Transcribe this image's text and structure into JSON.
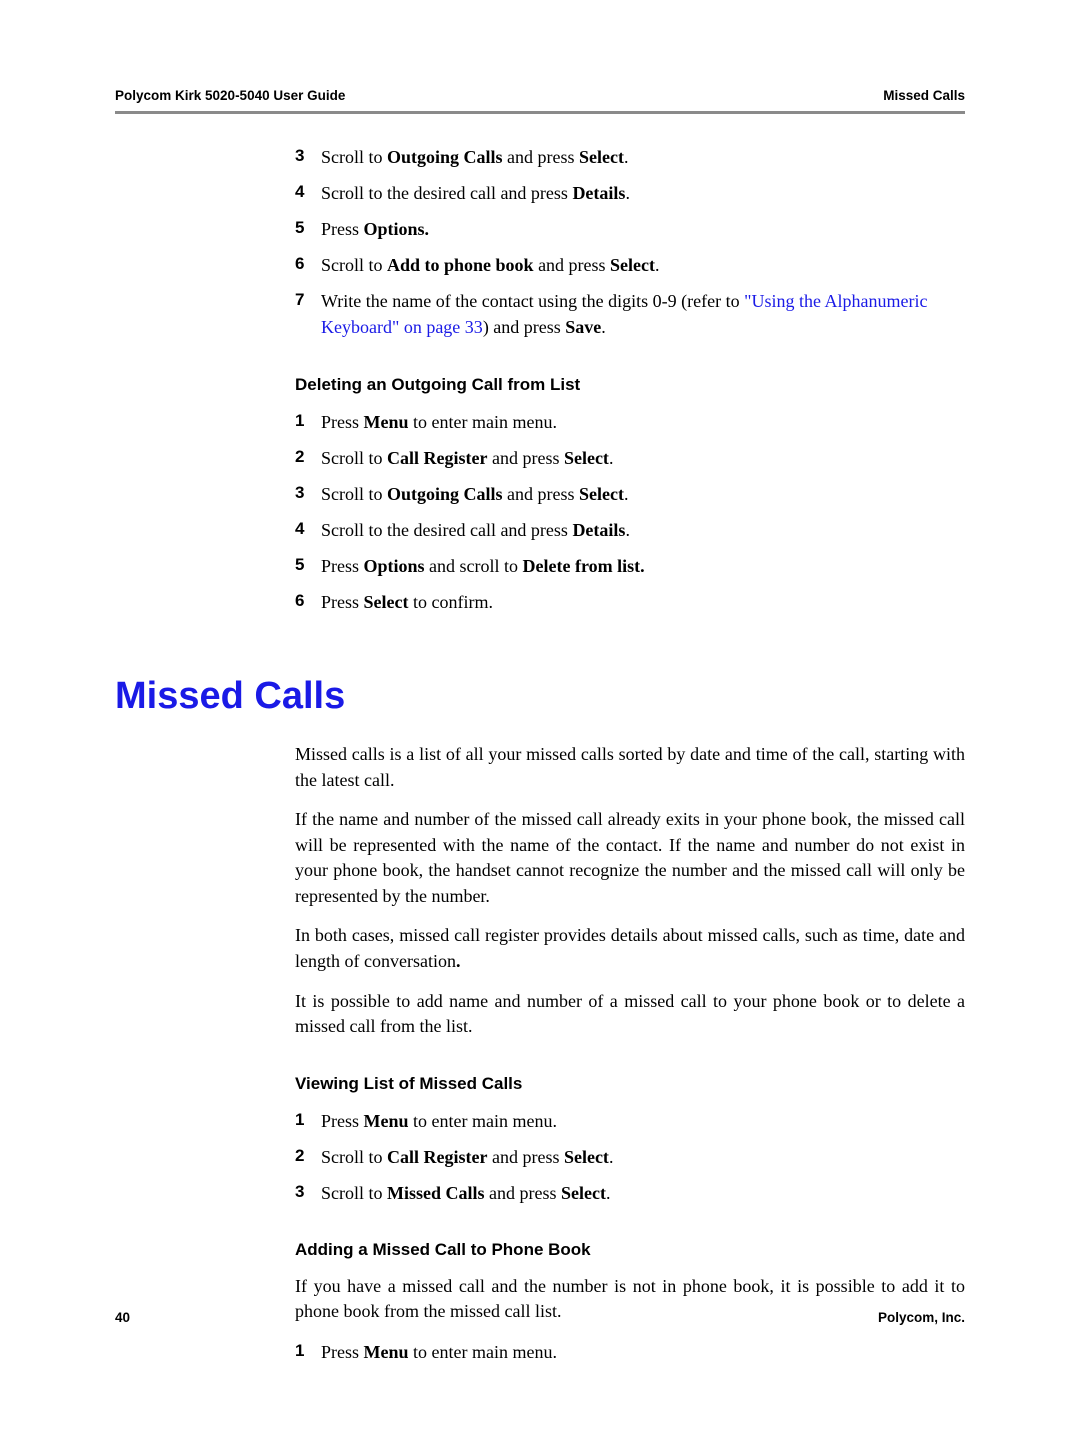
{
  "header": {
    "left": "Polycom Kirk 5020-5040 User Guide",
    "right": "Missed Calls"
  },
  "block1": {
    "steps": [
      {
        "num": "3",
        "pre": "Scroll to ",
        "b1": "Outgoing Calls",
        "mid": " and press ",
        "b2": "Select",
        "post": "."
      },
      {
        "num": "4",
        "pre": "Scroll to the desired call and press ",
        "b1": "Details",
        "mid": "",
        "b2": "",
        "post": "."
      },
      {
        "num": "5",
        "pre": "Press ",
        "b1": "Options.",
        "mid": "",
        "b2": "",
        "post": ""
      },
      {
        "num": "6",
        "pre": "Scroll to ",
        "b1": "Add to phone book",
        "mid": " and press ",
        "b2": "Select",
        "post": "."
      }
    ],
    "step7": {
      "num": "7",
      "t1": "Write the name of the contact using the digits 0-9 (refer to ",
      "link": "\"Using the Alphanumeric Keyboard\" on page 33",
      "t2": ") and press ",
      "b": "Save",
      "t3": "."
    }
  },
  "sub1": {
    "title": "Deleting an Outgoing Call from List",
    "steps": [
      {
        "num": "1",
        "pre": "Press ",
        "b1": "Menu",
        "mid": " to enter main menu.",
        "b2": "",
        "post": ""
      },
      {
        "num": "2",
        "pre": "Scroll to ",
        "b1": "Call Register",
        "mid": " and press ",
        "b2": "Select",
        "post": "."
      },
      {
        "num": "3",
        "pre": "Scroll to  ",
        "b1": "Outgoing Calls",
        "mid": " and press ",
        "b2": "Select",
        "post": "."
      },
      {
        "num": "4",
        "pre": "Scroll to the desired call and press ",
        "b1": "Details",
        "mid": "",
        "b2": "",
        "post": "."
      },
      {
        "num": "5",
        "pre": "Press ",
        "b1": "Options",
        "mid": " and scroll to ",
        "b2": "Delete from list.",
        "post": ""
      },
      {
        "num": "6",
        "pre": "Press ",
        "b1": "Select",
        "mid": " to confirm.",
        "b2": "",
        "post": ""
      }
    ]
  },
  "h1": "Missed Calls",
  "paras": [
    "Missed calls is a list of all your missed calls sorted by date and time of the call, starting with the latest call.",
    "If the name and number of the missed call already exits in your phone book, the missed call will be represented with the name of the contact. If the name and number do not exist in your phone book, the handset cannot recognize the number and the missed call will only be represented by the number.",
    "It is possible to add name and number of a missed call to your phone book or to delete a missed call from the list."
  ],
  "p3": {
    "t1": "In both cases, missed call register provides details about missed calls, such as time, date and length of conversation",
    "b": ".",
    "t2": ""
  },
  "sub2": {
    "title": "Viewing List of Missed Calls",
    "steps": [
      {
        "num": "1",
        "pre": "Press ",
        "b1": "Menu",
        "mid": " to enter main menu.",
        "b2": "",
        "post": ""
      },
      {
        "num": "2",
        "pre": "Scroll to ",
        "b1": "Call Register",
        "mid": " and press ",
        "b2": "Select",
        "post": "."
      },
      {
        "num": "3",
        "pre": "Scroll to ",
        "b1": "Missed Calls",
        "mid": " and press ",
        "b2": "Select",
        "post": "."
      }
    ]
  },
  "sub3": {
    "title": "Adding a Missed Call to Phone Book",
    "para": "If you have a missed call and the number is not in phone book, it is possible to add it to phone book from the missed call list.",
    "steps": [
      {
        "num": "1",
        "pre": "Press ",
        "b1": "Menu",
        "mid": " to enter main menu.",
        "b2": "",
        "post": ""
      }
    ]
  },
  "footer": {
    "left": "40",
    "right": "Polycom, Inc."
  }
}
